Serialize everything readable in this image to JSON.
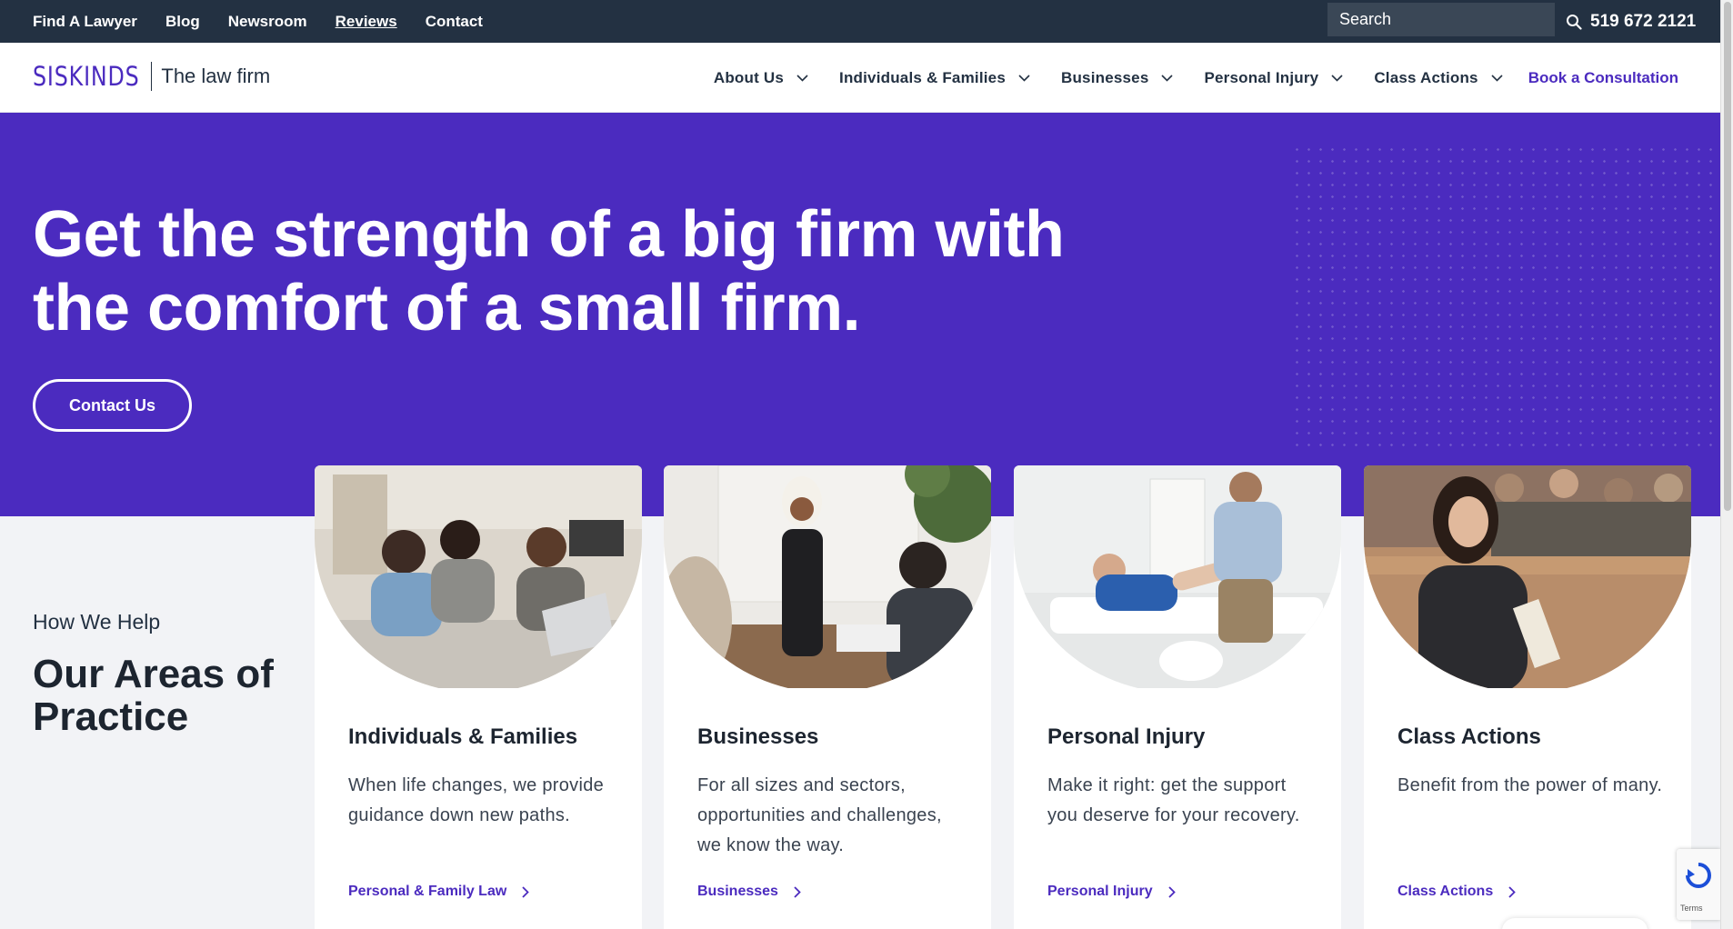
{
  "utility": {
    "links": [
      "Find A Lawyer",
      "Blog",
      "Newsroom",
      "Reviews",
      "Contact"
    ],
    "search_placeholder": "Search",
    "phone": "519 672 2121"
  },
  "nav": {
    "logo": "SISKINDS",
    "tagline": "The law firm",
    "items": [
      "About Us",
      "Individuals & Families",
      "Businesses",
      "Personal Injury",
      "Class Actions"
    ],
    "cta": "Book a Consultation"
  },
  "hero": {
    "title_line1": "Get the strength of a big firm with",
    "title_line2": "the comfort of a small firm.",
    "button": "Contact Us"
  },
  "section": {
    "label": "How We Help",
    "title": "Our Areas of Practice"
  },
  "cards": [
    {
      "title": "Individuals & Families",
      "desc": "When life changes, we provide guidance down new paths.",
      "link": "Personal & Family Law"
    },
    {
      "title": "Businesses",
      "desc": "For all sizes and sectors, opportunities and challenges, we know the way.",
      "link": "Businesses"
    },
    {
      "title": "Personal Injury",
      "desc": "Make it right: get the support you deserve for your recovery.",
      "link": "Personal Injury"
    },
    {
      "title": "Class Actions",
      "desc": "Benefit from the power of many.",
      "link": "Class Actions"
    }
  ],
  "recaptcha": {
    "terms": "Terms"
  },
  "colors": {
    "brand_purple": "#4b2bbf",
    "navy": "#233142",
    "page_bg": "#f2f3f6"
  },
  "icons": [
    "search-icon",
    "chevron-down-icon",
    "chevron-right-icon"
  ]
}
